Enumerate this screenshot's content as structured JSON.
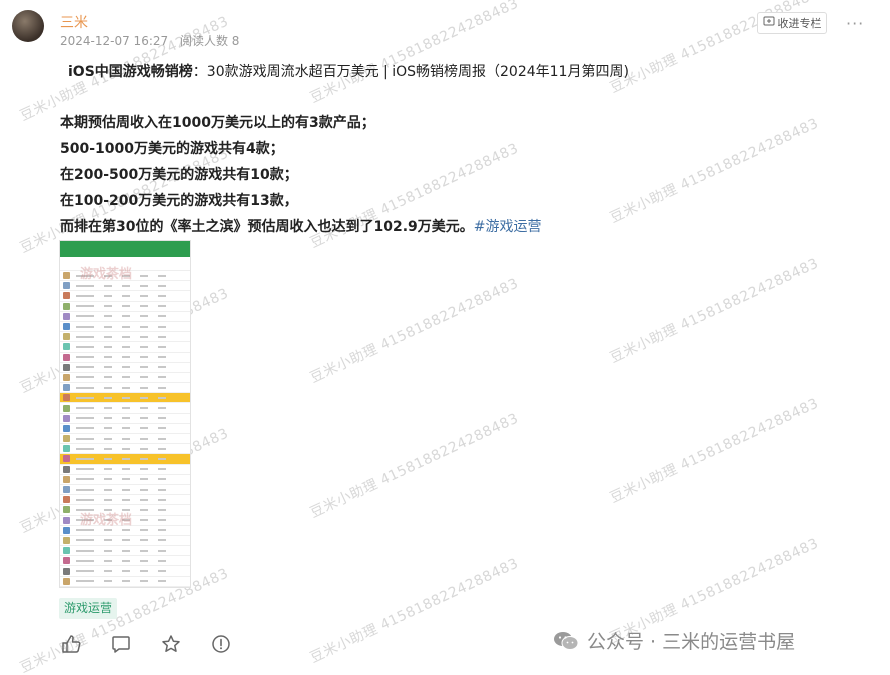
{
  "post": {
    "author": "三米",
    "timestamp": "2024-12-07 16:27",
    "read_count": "阅读人数 8",
    "collect_label": "收进专栏",
    "more_label": "···",
    "title_bold": "iOS中国游戏畅销榜",
    "title_rest": "：30款游戏周流水超百万美元 | iOS畅销榜周报（2024年11月第四周)",
    "body_lines": [
      "本期预估周收入在1000万美元以上的有3款产品；",
      "500-1000万美元的游戏共有4款；",
      "在200-500万美元的游戏共有10款；",
      "在100-200万美元的游戏共有13款，",
      "而排在第30位的《率土之滨》预估周收入也达到了102.9万美元。"
    ],
    "inline_tag": "#游戏运营",
    "topic_chip": "游戏运营"
  },
  "actions": {
    "icons": [
      "thumb-up-icon",
      "comment-icon",
      "star-icon",
      "report-icon"
    ]
  },
  "footer": {
    "brand": "公众号 · 三米的运营书屋"
  },
  "watermark": {
    "text": "豆米小助理 4158188224288483"
  },
  "image_watermark": {
    "text": "游戏茶档"
  },
  "colors": {
    "author": "#e8964f",
    "tag": "#3e6ea3",
    "chip_bg": "#e6f4ee",
    "chip_text": "#2e9b6d",
    "thumb_header": "#2e9d4f",
    "thumb_highlight": "#f7c22a"
  }
}
